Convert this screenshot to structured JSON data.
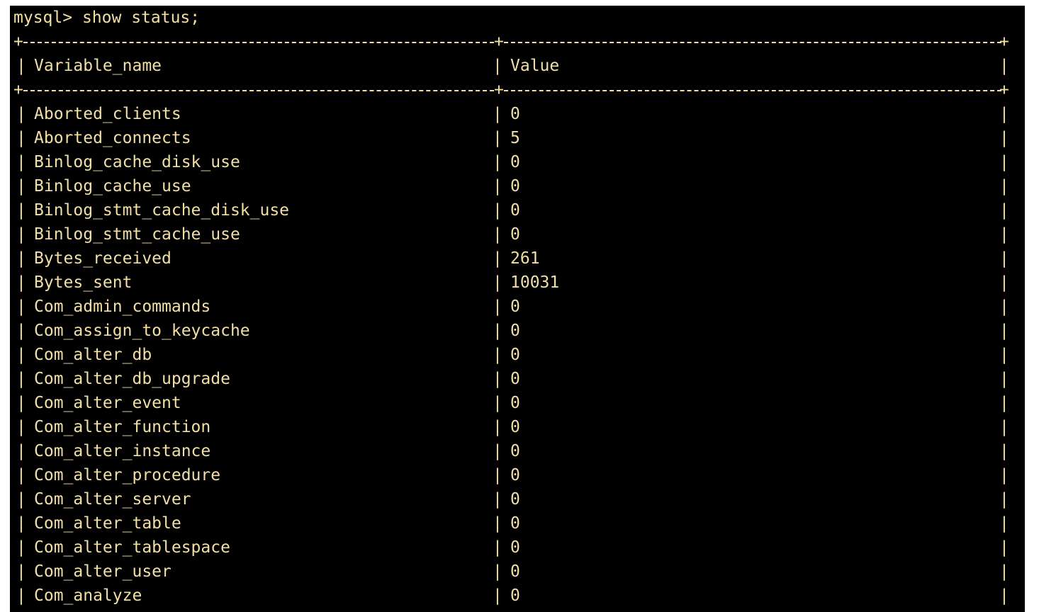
{
  "terminal": {
    "prompt": "mysql>",
    "command": "show status;"
  },
  "table": {
    "headers": [
      "Variable_name",
      "Value"
    ],
    "rows": [
      {
        "name": "Aborted_clients",
        "value": "0"
      },
      {
        "name": "Aborted_connects",
        "value": "5"
      },
      {
        "name": "Binlog_cache_disk_use",
        "value": "0"
      },
      {
        "name": "Binlog_cache_use",
        "value": "0"
      },
      {
        "name": "Binlog_stmt_cache_disk_use",
        "value": "0"
      },
      {
        "name": "Binlog_stmt_cache_use",
        "value": "0"
      },
      {
        "name": "Bytes_received",
        "value": "261"
      },
      {
        "name": "Bytes_sent",
        "value": "10031"
      },
      {
        "name": "Com_admin_commands",
        "value": "0"
      },
      {
        "name": "Com_assign_to_keycache",
        "value": "0"
      },
      {
        "name": "Com_alter_db",
        "value": "0"
      },
      {
        "name": "Com_alter_db_upgrade",
        "value": "0"
      },
      {
        "name": "Com_alter_event",
        "value": "0"
      },
      {
        "name": "Com_alter_function",
        "value": "0"
      },
      {
        "name": "Com_alter_instance",
        "value": "0"
      },
      {
        "name": "Com_alter_procedure",
        "value": "0"
      },
      {
        "name": "Com_alter_server",
        "value": "0"
      },
      {
        "name": "Com_alter_table",
        "value": "0"
      },
      {
        "name": "Com_alter_tablespace",
        "value": "0"
      },
      {
        "name": "Com_alter_user",
        "value": "0"
      },
      {
        "name": "Com_analyze",
        "value": "0"
      }
    ]
  },
  "colors": {
    "background": "#000000",
    "text": "#f2dfa6"
  }
}
